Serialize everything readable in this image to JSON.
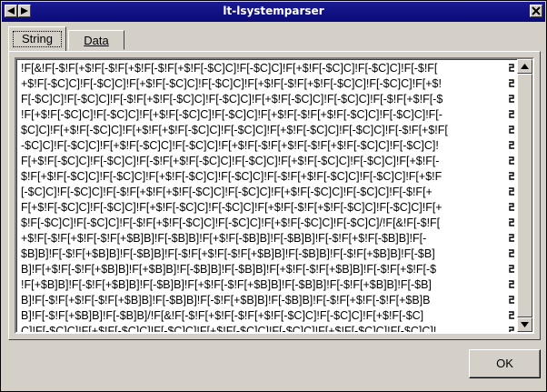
{
  "window": {
    "title": "lt-lsystemparser"
  },
  "tabs": [
    {
      "label": "String",
      "active": true
    },
    {
      "label": "Data",
      "active": false
    }
  ],
  "lines": [
    "!F[&!F[-$!F[+$!F[-$!F[+$!F[-$!F[+$!F[-$C]C]!F[-$C]C]!F[+$!F[-$C]C]!F[-$C]C]!F[-$!F[",
    "+$!F[-$C]C]!F[-$C]C]!F[+$!F[-$C]C]!F[-$C]C]!F[+$!F[-$!F[+$!F[-$C]C]!F[-$C]C]!F[+$!",
    "F[-$C]C]!F[-$C]C]!F[-$!F[+$!F[-$C]C]!F[-$C]C]!F[+$!F[-$C]C]!F[-$C]C]!F[-$!F[+$!F[-$",
    "!F[+$!F[-$C]C]!F[-$C]C]!F[+$!F[-$C]C]!F[-$C]C]!F[+$!F[-$!F[+$!F[-$C]C]!F[-$C]C]!F[-",
    "$C]C]!F[+$!F[-$C]C]!F[+$!F[+$!F[-$C]C]!F[-$C]C]!F[+$!F[-$C]C]!F[-$C]C]!F[-$!F[+$!F[",
    "-$C]C]!F[-$C]C]!F[+$!F[-$C]C]!F[-$C]C]!F[+$!F[-$!F[+$!F[-$!F[+$!F[-$C]C]!F[-$C]C]!",
    "F[+$!F[-$C]C]!F[-$C]C]!F[-$!F[+$!F[-$C]C]!F[-$C]C]!F[+$!F[-$C]C]!F[-$C]C]!F[+$!F[-",
    "$!F[+$!F[-$C]C]!F[-$C]C]!F[+$!F[-$C]C]!F[-$C]C]!F[-$!F[+$!F[-$C]C]!F[-$C]C]!F[+$!F",
    "[-$C]C]!F[-$C]C]!F[-$!F[+$!F[+$!F[-$C]C]!F[-$C]C]!F[+$!F[-$C]C]!F[-$C]C]!F[-$!F[+",
    "F[+$!F[-$C]C]!F[-$C]C]!F[+$!F[-$C]C]!F[-$C]C]!F[+$!F[-$!F[+$!F[-$C]C]!F[-$C]C]!F[+",
    "$!F[-$C]C]!F[-$C]C]!F[-$!F[+$!F[-$C]C]!F[-$C]C]!F[+$!F[-$C]C]!F[-$C]C]/!F[&!F[-$!F[",
    "+$!F[-$!F[+$!F[-$!F[+$B]B]!F[-$B]B]!F[+$!F[-$B]B]!F[-$B]B]!F[-$!F[+$!F[-$B]B]!F[-",
    "$B]B]!F[-$!F[+$B]B]!F[-$B]B]!F[-$!F[+$!F[-$!F[+$B]B]!F[-$B]B]!F[-$!F[+$B]B]!F[-$B]",
    "B]!F[+$!F[-$!F[+$B]B]!F[+$B]B]!F[-$B]B]!F[-$B]B]!F[+$!F[-$!F[+$B]B]!F[-$!F[+$!F[-$",
    "!F[+$B]B]!F[-$!F[+$B]B]!F[-$B]B]!F[+$!F[-$!F[+$B]B]!F[-$B]B]!F[-$!F[+$B]B]!F[-$B]",
    "B]!F[-$!F[+$!F[-$!F[+$B]B]!F[-$B]B]!F[-$!F[+$B]B]!F[-$B]B]!F[-$!F[+$!F[-$!F[+$B]B",
    "B]!F[-$!F[+$B]B]!F[-$B]B]/!F[&!F[-$!F[+$!F[-$!F[+$!F[-$C]C]!F[-$C]C]!F[+$!F[-$C]",
    "C]!F[-$C]C]!F[+$!F[-$C]C]!F[-$C]C]!F[+$!F[-$C]C]!F[-$C]C]!F[+$!F[-$C]C]!F[-$C]C]!"
  ],
  "buttons": {
    "ok": "OK"
  }
}
